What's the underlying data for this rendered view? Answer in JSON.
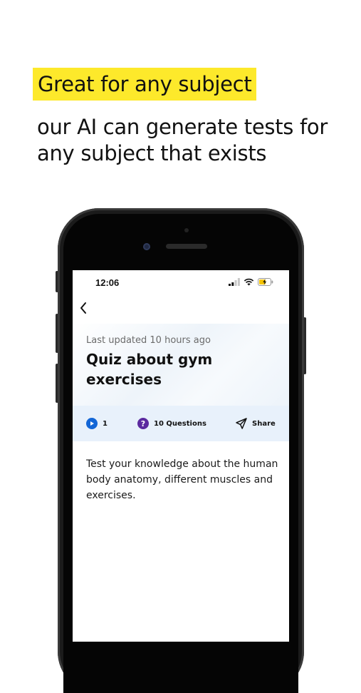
{
  "marketing": {
    "headline": "Great for any subject",
    "subline": "our AI can generate tests for any subject that exists"
  },
  "status_bar": {
    "time": "12:06"
  },
  "quiz": {
    "updated": "Last updated 10 hours ago",
    "title": "Quiz about gym exercises",
    "plays": "1",
    "questions": "10 Questions",
    "share_label": "Share",
    "description": "Test your knowledge about the human body anatomy, different muscles and exercises."
  },
  "icons": {
    "back": "chevron-left-icon",
    "play": "play-icon",
    "question": "question-icon",
    "share": "send-icon",
    "signal": "cellular-signal-icon",
    "wifi": "wifi-icon",
    "battery": "battery-charging-icon"
  },
  "colors": {
    "highlight": "#fde92b",
    "play": "#1366d6",
    "question": "#5b2a9f",
    "meta_bar": "#e8f1fb",
    "battery": "#f5c400"
  }
}
